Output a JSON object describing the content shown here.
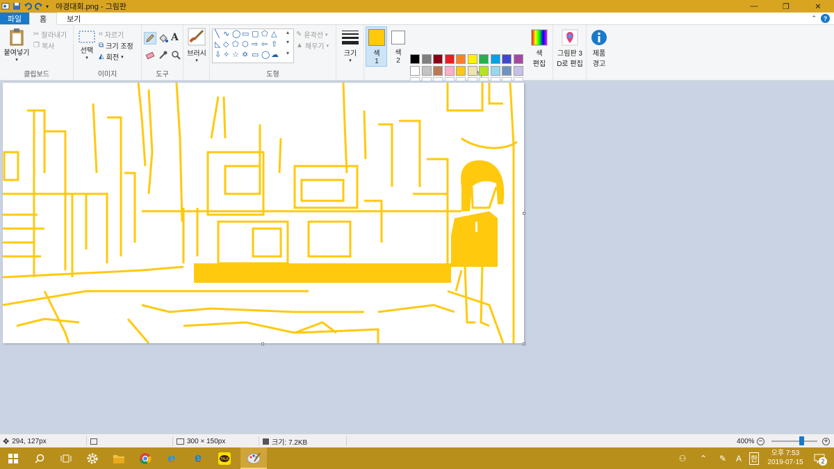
{
  "window": {
    "title": "야경대회.png - 그림판",
    "controls": {
      "minimize": "—",
      "maximize": "❐",
      "close": "✕"
    }
  },
  "tabs": {
    "file": "파일",
    "home": "홈",
    "view": "보기"
  },
  "ribbon": {
    "clipboard": {
      "paste": "붙여넣기",
      "cut": "잘라내기",
      "copy": "복사",
      "label": "클립보드"
    },
    "image": {
      "select": "선택",
      "crop": "자르기",
      "resize": "크기 조정",
      "rotate": "회전",
      "label": "이미지"
    },
    "tools": {
      "label": "도구",
      "text_tool": "A"
    },
    "brush": {
      "label": "브러시"
    },
    "shapes": {
      "outline": "윤곽선",
      "fill": "채우기",
      "label": "도형"
    },
    "size": {
      "label": "크기"
    },
    "color1": {
      "line1": "색",
      "line2": "1",
      "value": "#ffc90e"
    },
    "color2": {
      "line1": "색",
      "line2": "2",
      "value": "#ffffff"
    },
    "colors_label": "색",
    "edit_colors": {
      "line1": "색",
      "line2": "편집"
    },
    "paint3d": {
      "line1": "그림판 3",
      "line2": "D로 편집"
    },
    "product_alert": {
      "line1": "제품",
      "line2": "경고"
    },
    "palette": [
      "#000000",
      "#7f7f7f",
      "#880015",
      "#ed1c24",
      "#ff7f27",
      "#fff200",
      "#22b14c",
      "#00a2e8",
      "#3f48cc",
      "#a349a4",
      "#ffffff",
      "#c3c3c3",
      "#b97a57",
      "#ffaec9",
      "#ffc90e",
      "#efe4b0",
      "#b5e61d",
      "#99d9ea",
      "#7092be",
      "#c8bfe7"
    ]
  },
  "status": {
    "cursor_pos": "294, 127px",
    "dimensions": "300 × 150px",
    "filesize": "크기: 7.2KB",
    "zoom": "400%",
    "zoom_fraction": 0.68
  },
  "taskbar": {
    "time": "오후 7:53",
    "date": "2019-07-15",
    "ime": "한",
    "ime_alt": "A",
    "notifications": "2"
  }
}
